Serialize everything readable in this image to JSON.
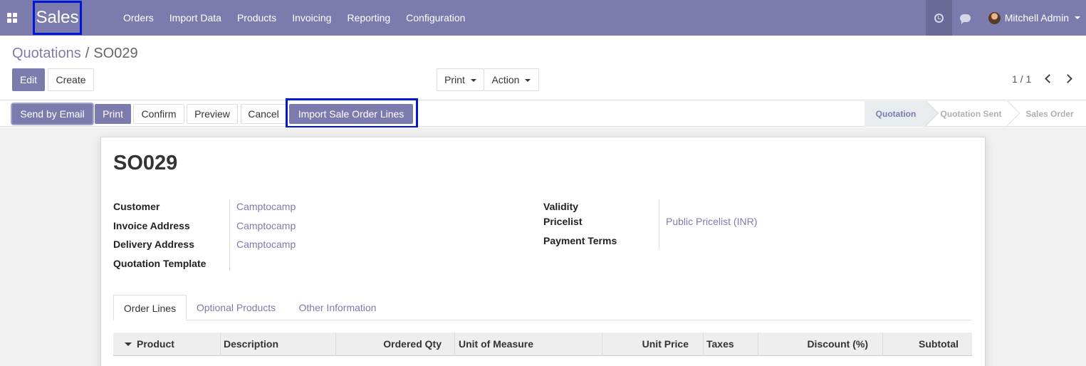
{
  "navbar": {
    "brand": "Sales",
    "menu": [
      "Orders",
      "Import Data",
      "Products",
      "Invoicing",
      "Reporting",
      "Configuration"
    ],
    "user_name": "Mitchell Admin"
  },
  "breadcrumb": {
    "parent": "Quotations",
    "separator": "/",
    "current": "SO029"
  },
  "controls": {
    "edit": "Edit",
    "create": "Create",
    "print": "Print",
    "action": "Action",
    "pager": "1 / 1"
  },
  "statusbar": {
    "buttons": [
      "Send by Email",
      "Print",
      "Confirm",
      "Preview",
      "Cancel",
      "Import Sale Order Lines"
    ],
    "stages": [
      "Quotation",
      "Quotation Sent",
      "Sales Order"
    ],
    "active_stage": "Quotation"
  },
  "form": {
    "title": "SO029",
    "left_fields": [
      {
        "label": "Customer",
        "value": "Camptocamp"
      },
      {
        "label": "Invoice Address",
        "value": "Camptocamp"
      },
      {
        "label": "Delivery Address",
        "value": "Camptocamp"
      },
      {
        "label": "Quotation Template",
        "value": ""
      }
    ],
    "right_fields": [
      {
        "label": "Validity",
        "value": ""
      },
      {
        "label": "Pricelist",
        "value": "Public Pricelist (INR)"
      },
      {
        "label": "Payment Terms",
        "value": ""
      }
    ],
    "tabs": [
      "Order Lines",
      "Optional Products",
      "Other Information"
    ],
    "columns": [
      "Product",
      "Description",
      "Ordered Qty",
      "Unit of Measure",
      "Unit Price",
      "Taxes",
      "Discount (%)",
      "Subtotal"
    ]
  },
  "colors": {
    "brand": "#7c7bad",
    "highlight": "#0018d6"
  }
}
